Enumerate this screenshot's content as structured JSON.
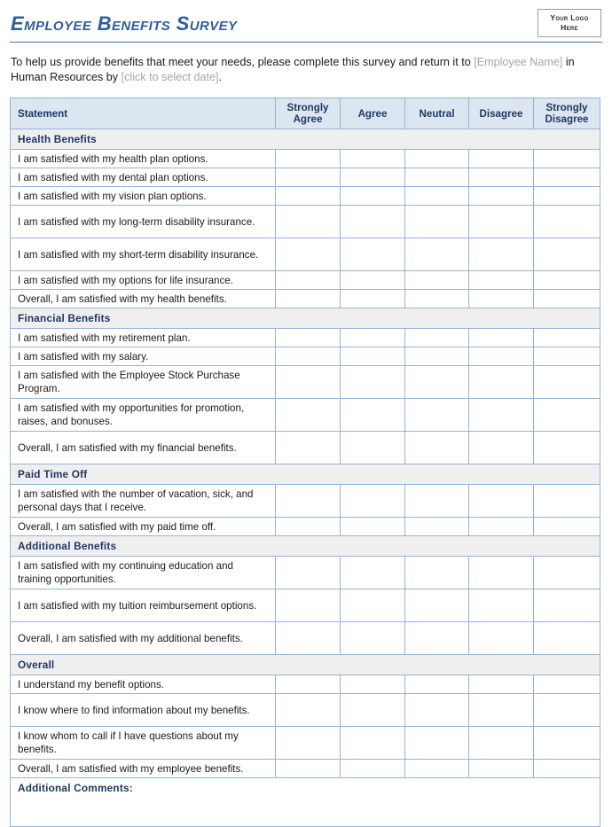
{
  "header": {
    "title": "Employee Benefits Survey",
    "logo_line1": "Your Logo",
    "logo_line2": "Here"
  },
  "intro": {
    "text_part1": "To help us provide benefits that meet your needs, please complete this survey and return it to ",
    "placeholder_employee": "[Employee Name]",
    "text_part2": " in Human Resources by ",
    "placeholder_date": "[click to select date]",
    "text_part3": "."
  },
  "table": {
    "columns": [
      "Statement",
      "Strongly Agree",
      "Agree",
      "Neutral",
      "Disagree",
      "Strongly Disagree"
    ],
    "sections": [
      {
        "name": "Health Benefits",
        "items": [
          "I am satisfied with my health plan options.",
          "I am satisfied with my dental plan options.",
          "I am satisfied with my vision plan options.",
          "I am satisfied with my long-term disability insurance.",
          "I am satisfied with my short-term disability insurance.",
          "I am satisfied with my options for life insurance.",
          "Overall, I am satisfied with my health benefits."
        ]
      },
      {
        "name": "Financial Benefits",
        "items": [
          "I am satisfied with my retirement plan.",
          "I am satisfied with my salary.",
          "I am satisfied with the Employee Stock Purchase Program.",
          "I am satisfied with my opportunities for promotion, raises, and bonuses.",
          "Overall, I am satisfied with my financial benefits."
        ]
      },
      {
        "name": "Paid Time Off",
        "items": [
          "I am satisfied with the number of vacation, sick, and personal days that I receive.",
          "Overall, I am satisfied with my paid time off."
        ]
      },
      {
        "name": "Additional  Benefits",
        "items": [
          "I am satisfied with my continuing education and training opportunities.",
          "I am satisfied with my tuition reimbursement options.",
          "Overall, I am satisfied with my additional benefits."
        ]
      },
      {
        "name": "Overall",
        "items": [
          "I understand my benefit options.",
          "I know where to find information about my benefits.",
          "I know whom to call if I have questions about my benefits.",
          "Overall, I am satisfied with my employee benefits."
        ]
      }
    ],
    "comments_label": "Additional  Comments:"
  },
  "colors": {
    "title_blue": "#2F5D9E",
    "header_fill": "#DCE6F1",
    "section_fill": "#EFEFEF",
    "border_blue": "#95B3D7",
    "heading_text": "#1F3864",
    "placeholder_gray": "#A6A6A6"
  }
}
